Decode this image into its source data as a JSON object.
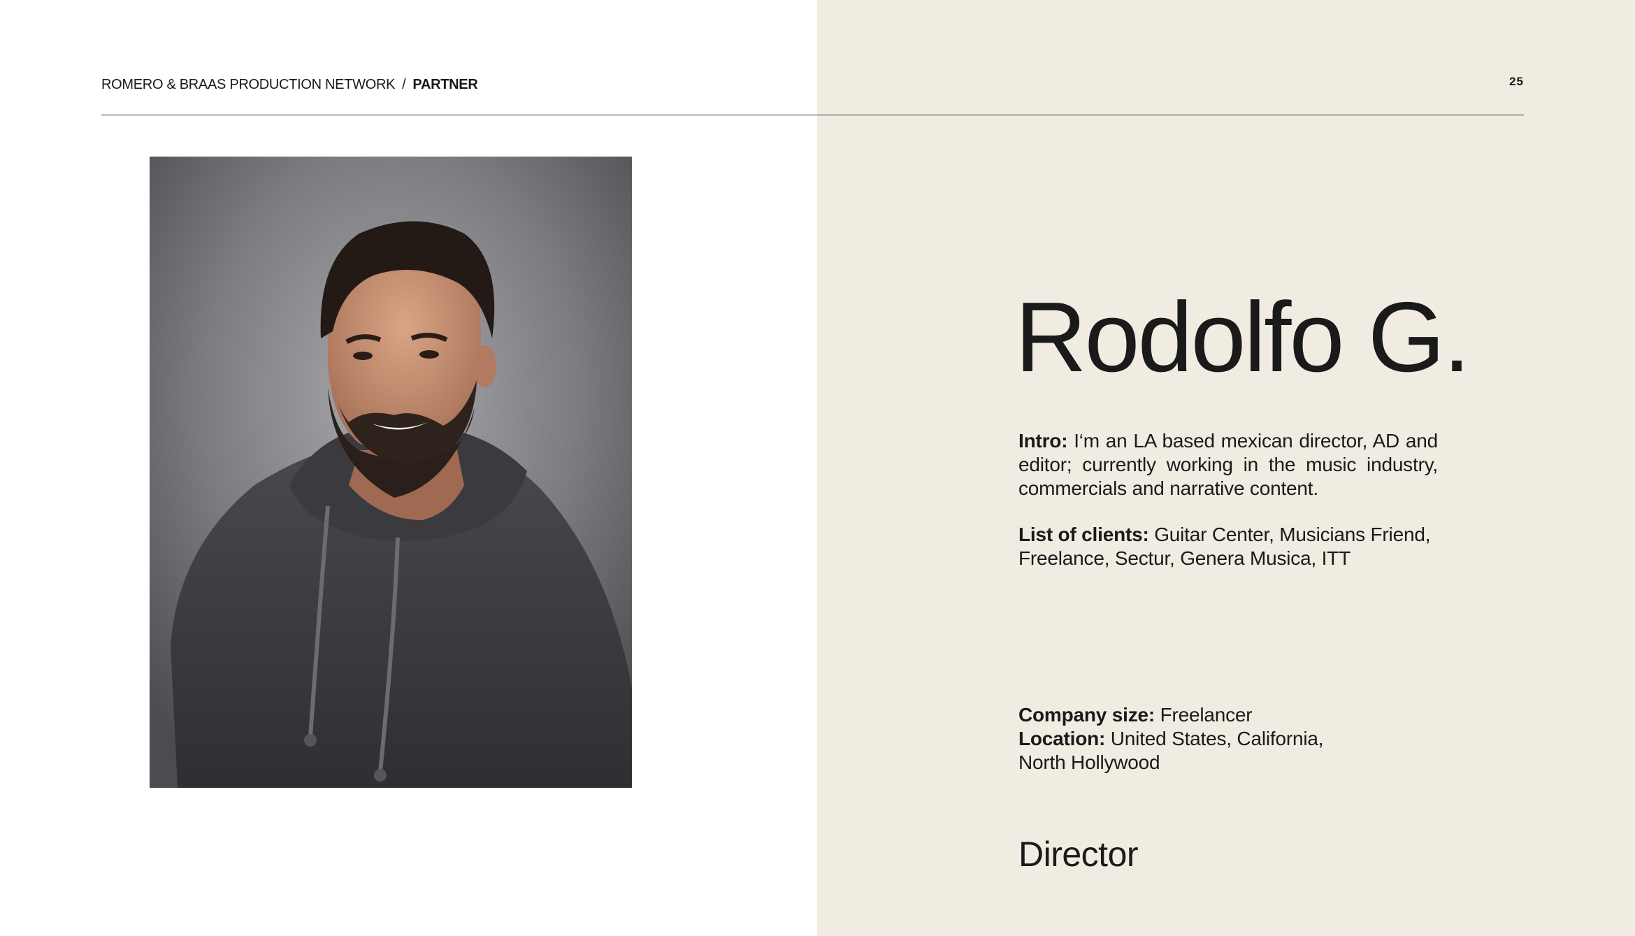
{
  "header": {
    "network": "ROMERO & BRAAS PRODUCTION NETWORK",
    "separator": "/",
    "section": "PARTNER",
    "page_number": "25"
  },
  "profile": {
    "name": "Rodolfo G.",
    "intro_label": "Intro:",
    "intro_text": "I‘m an LA based mexican director, AD and editor; currently working in the music industry, commercials and narrative content.",
    "clients_label": "List of clients:",
    "clients_text": "Guitar Center, Musicians Friend, Freelance, Sectur, Genera Musica, ITT",
    "company_size_label": "Company size:",
    "company_size_value": "Freelancer",
    "location_label": "Location:",
    "location_value": "United States, California, North Hollywood",
    "role": "Director"
  },
  "colors": {
    "panel_background": "#f0ece2",
    "text": "#1a1a1a"
  }
}
